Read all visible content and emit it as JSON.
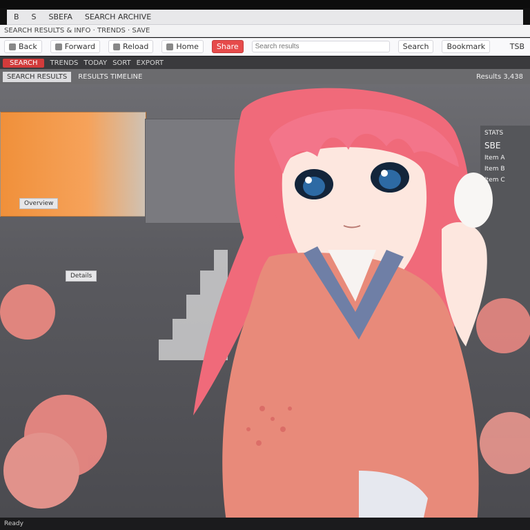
{
  "window": {
    "tabs": [
      "B",
      "S",
      "SBEFA",
      "SEARCH ARCHIVE"
    ],
    "url_text": "SEARCH RESULTS & INFO · TRENDS · SAVE"
  },
  "toolbar": {
    "buttons": [
      "Back",
      "Forward",
      "Reload",
      "Home",
      "Share",
      "Search",
      "Bookmark"
    ],
    "search_placeholder": "Search results",
    "right_label": "TSB"
  },
  "header": {
    "badge_label": "SEARCH",
    "filters": [
      "TRENDS",
      "TODAY",
      "SORT",
      "EXPORT"
    ]
  },
  "subheader": {
    "left_label": "SEARCH RESULTS",
    "center_label": "RESULTS TIMELINE",
    "stats_label": "Results 3,438"
  },
  "dashboard": {
    "chips": [
      "Overview",
      "Details"
    ],
    "right_panel": {
      "title": "STATS",
      "big_label": "SBE",
      "rows": [
        "Item A",
        "Item B",
        "Item C"
      ]
    }
  },
  "colors": {
    "accent": "#e64b4b",
    "orange": "#f0903a",
    "hair": "#f06a7a",
    "kimono": "#e88a7a",
    "dark": "#3a3a3d"
  },
  "status": {
    "left": "Ready"
  }
}
